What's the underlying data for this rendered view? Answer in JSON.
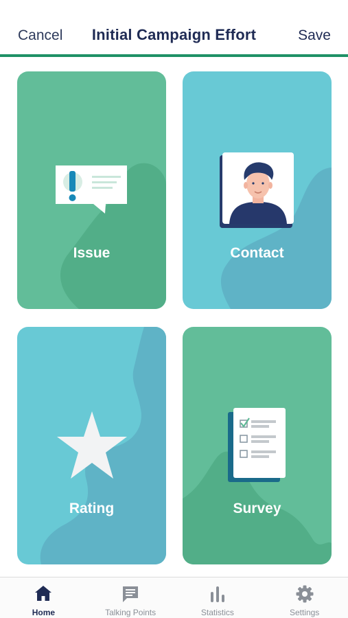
{
  "header": {
    "cancel_label": "Cancel",
    "title": "Initial Campaign Effort",
    "save_label": "Save"
  },
  "cards": [
    {
      "label": "Issue",
      "icon": "alert-speech-bubble-icon"
    },
    {
      "label": "Contact",
      "icon": "person-portrait-icon"
    },
    {
      "label": "Rating",
      "icon": "star-icon"
    },
    {
      "label": "Survey",
      "icon": "checklist-document-icon"
    }
  ],
  "tabbar": {
    "tabs": [
      {
        "label": "Home",
        "icon": "home-icon",
        "active": true
      },
      {
        "label": "Talking Points",
        "icon": "chat-bubble-icon",
        "active": false
      },
      {
        "label": "Statistics",
        "icon": "bar-chart-icon",
        "active": false
      },
      {
        "label": "Settings",
        "icon": "gear-icon",
        "active": false
      }
    ]
  },
  "colors": {
    "navy": "#1f2b54",
    "green_card": "#62bd99",
    "teal_card": "#68c9d5",
    "accent_line": "#1f9166"
  }
}
